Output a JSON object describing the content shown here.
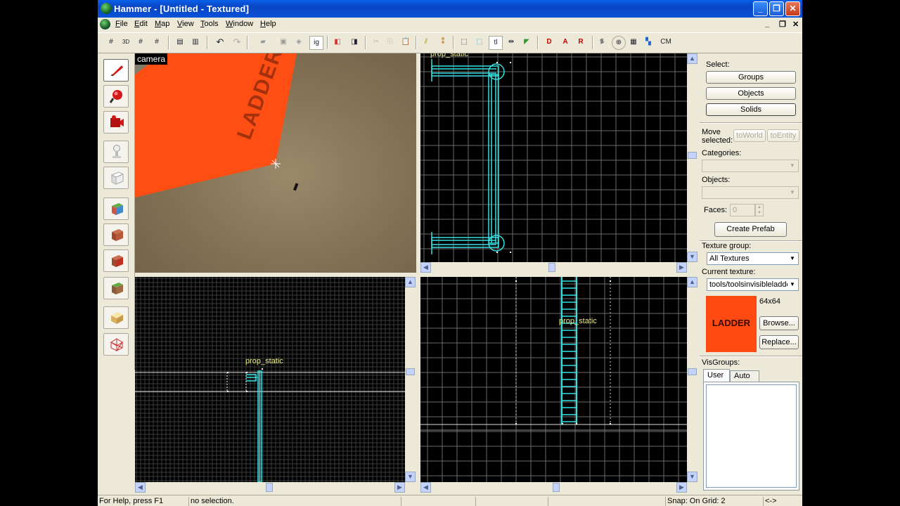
{
  "window": {
    "title": "Hammer - [Untitled - Textured]"
  },
  "menu": {
    "items": [
      {
        "key": "F",
        "rest": "ile"
      },
      {
        "key": "E",
        "rest": "dit"
      },
      {
        "key": "M",
        "rest": "ap"
      },
      {
        "key": "V",
        "rest": "iew"
      },
      {
        "key": "T",
        "rest": "ools"
      },
      {
        "key": "W",
        "rest": "indow"
      },
      {
        "key": "H",
        "rest": "elp"
      }
    ]
  },
  "toolbar": {
    "cordon_label": "CM",
    "texture_lock_label": "tl"
  },
  "viewports": {
    "camera_label": "camera",
    "top_right_object_label": "prop_static",
    "bottom_left_object_label": "prop_static",
    "bottom_right_object_label": "prop_static",
    "camera_texture_text": "LADDER"
  },
  "panel": {
    "select_label": "Select:",
    "groups_button": "Groups",
    "objects_button": "Objects",
    "solids_button": "Solids",
    "move_selected_label": "Move selected:",
    "to_world_button": "toWorld",
    "to_entity_button": "toEntity",
    "categories_label": "Categories:",
    "objects_label": "Objects:",
    "faces_label": "Faces:",
    "faces_value": "0",
    "create_prefab_button": "Create Prefab",
    "texture_group_label": "Texture group:",
    "texture_group_value": "All Textures",
    "current_texture_label": "Current texture:",
    "current_texture_value": "tools/toolsinvisibleladder",
    "texture_size": "64x64",
    "texture_preview_text": "LADDER",
    "browse_button": "Browse...",
    "replace_button": "Replace...",
    "visgroups_label": "VisGroups:",
    "visgroups_tabs": [
      "User",
      "Auto"
    ]
  },
  "status": {
    "help": "For Help, press F1",
    "selection": "no selection.",
    "snap": "Snap: On Grid: 2",
    "extra": "<->"
  },
  "colors": {
    "titlebar": "#0a52d8",
    "brush_cyan": "#35e0e0",
    "label_yellow": "#ecec8a",
    "ladder_orange": "#ff4a12",
    "grid_line": "#5a5a5a"
  }
}
